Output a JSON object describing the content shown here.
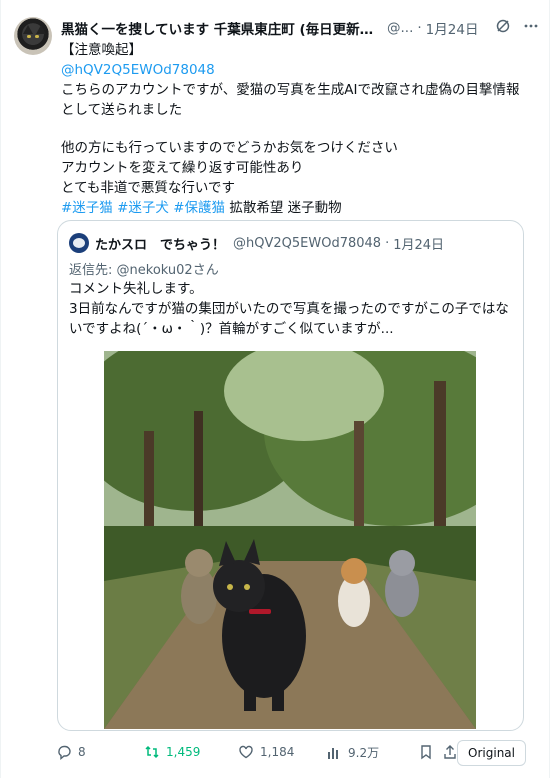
{
  "post": {
    "author_name": "黒猫く一を捜しています 千葉県東庄町 (毎日更新。...",
    "author_handle": "@...",
    "date": "1月24日",
    "lines": [
      "【注意喚起】",
      "@hQV2Q5EWOd78048",
      "こちらのアカウントですが、愛猫の写真を生成AIで改竄され虚偽の目撃情報",
      "として送られました",
      "他の方にも行っていますのでどうかお気をつけください",
      "アカウントを変えて繰り返す可能性あり",
      "とても非道で悪質な行いです"
    ],
    "hashtags": [
      "#迷子猫",
      "#迷子犬",
      "#保護猫"
    ],
    "tail_text": "拡散希望 迷子動物"
  },
  "quote": {
    "author_name": "たかスロ　でちゃう！",
    "author_handle": "@hQV2Q5EWOd78048",
    "date": "1月24日",
    "replying_label": "返信先:",
    "replying_to": "@nekoku02さん",
    "lines": [
      "コメント失礼します。",
      "3日前なんですが猫の集団がいたので写真を撮ったのですがこの子ではな",
      "いですよね(´・ω・｀)？首輪がすごく似ていますが..."
    ]
  },
  "actions": {
    "replies": "8",
    "retweets": "1,459",
    "likes": "1,184",
    "views": "9.2万",
    "original_label": "Original"
  },
  "colors": {
    "link": "#1d9bf0",
    "retweet_green": "#00ba7c",
    "muted": "#536471",
    "border": "#cfd9de"
  },
  "icons": [
    "grok-icon",
    "more-icon",
    "reply-icon",
    "retweet-icon",
    "like-icon",
    "views-icon",
    "bookmark-icon",
    "share-icon"
  ]
}
